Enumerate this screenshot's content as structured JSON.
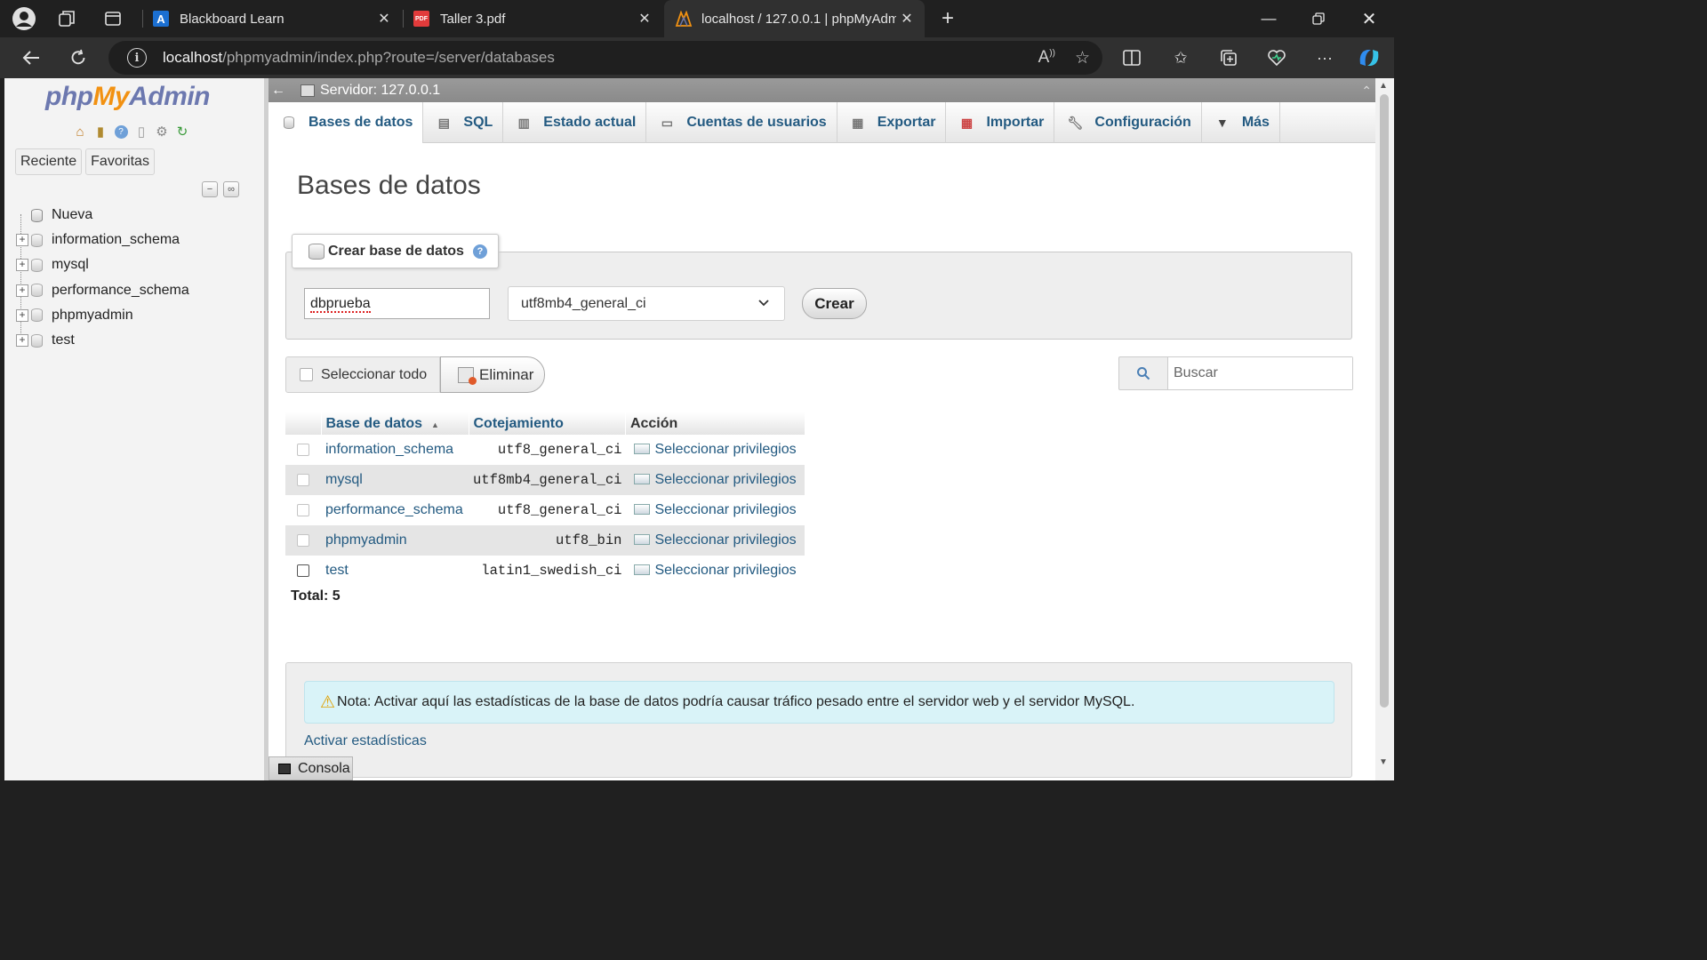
{
  "browser": {
    "tabs": [
      {
        "title": "Blackboard Learn",
        "favicon": "blackboard-icon",
        "active": false
      },
      {
        "title": "Taller 3.pdf",
        "favicon": "pdf-icon",
        "active": false
      },
      {
        "title": "localhost / 127.0.0.1 | phpMyAdm",
        "favicon": "phpmyadmin-icon",
        "active": true
      }
    ],
    "url_host": "localhost",
    "url_path": "/phpmyadmin/index.php?route=/server/databases"
  },
  "nav": {
    "logo_php": "php",
    "logo_my": "My",
    "logo_admin": "Admin",
    "tabs": [
      "Reciente",
      "Favoritas"
    ],
    "tree": [
      {
        "label": "Nueva",
        "type": "new"
      },
      {
        "label": "information_schema",
        "type": "db"
      },
      {
        "label": "mysql",
        "type": "db"
      },
      {
        "label": "performance_schema",
        "type": "db"
      },
      {
        "label": "phpmyadmin",
        "type": "db"
      },
      {
        "label": "test",
        "type": "db"
      }
    ]
  },
  "server": {
    "breadcrumb": "Servidor: 127.0.0.1"
  },
  "menu": [
    {
      "label": "Bases de datos",
      "icon": "database-icon",
      "active": true
    },
    {
      "label": "SQL",
      "icon": "sql-icon",
      "active": false
    },
    {
      "label": "Estado actual",
      "icon": "status-icon",
      "active": false
    },
    {
      "label": "Cuentas de usuarios",
      "icon": "users-icon",
      "active": false
    },
    {
      "label": "Exportar",
      "icon": "export-icon",
      "active": false
    },
    {
      "label": "Importar",
      "icon": "import-icon",
      "active": false
    },
    {
      "label": "Configuración",
      "icon": "wrench-icon",
      "active": false
    },
    {
      "label": "Más",
      "icon": "caret-down-icon",
      "active": false
    }
  ],
  "main": {
    "title": "Bases de datos",
    "create": {
      "legend": "Crear base de datos",
      "name_value": "dbprueba",
      "collation_value": "utf8mb4_general_ci",
      "button": "Crear"
    },
    "select_all": "Seleccionar todo",
    "delete_button": "Eliminar",
    "search_placeholder": "Buscar",
    "table": {
      "headers": [
        "Base de datos",
        "Cotejamiento",
        "Acción"
      ],
      "rows": [
        {
          "name": "information_schema",
          "collation": "utf8_general_ci",
          "action": "Seleccionar privilegios"
        },
        {
          "name": "mysql",
          "collation": "utf8mb4_general_ci",
          "action": "Seleccionar privilegios"
        },
        {
          "name": "performance_schema",
          "collation": "utf8_general_ci",
          "action": "Seleccionar privilegios"
        },
        {
          "name": "phpmyadmin",
          "collation": "utf8_bin",
          "action": "Seleccionar privilegios"
        },
        {
          "name": "test",
          "collation": "latin1_swedish_ci",
          "action": "Seleccionar privilegios"
        }
      ]
    },
    "total": "Total: 5",
    "notice": "Nota: Activar aquí las estadísticas de la base de datos podría causar tráfico pesado entre el servidor web y el servidor MySQL.",
    "stats_link": "Activar estadísticas",
    "console": "Consola"
  },
  "colors": {
    "link": "#235a81",
    "logo_blue": "#6c78af",
    "logo_orange": "#f29111",
    "notice_bg": "#d9f3f8"
  }
}
